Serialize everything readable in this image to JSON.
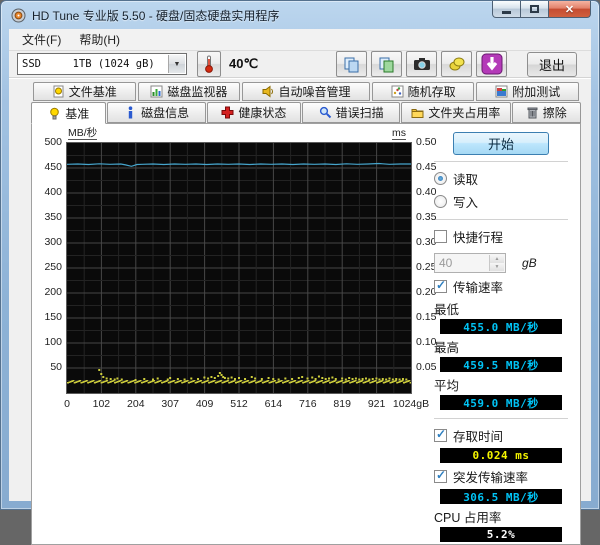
{
  "window_title": "HD Tune 专业版 5.50 - 硬盘/固态硬盘实用程序",
  "menu": {
    "file": "文件(F)",
    "help": "帮助(H)"
  },
  "toolbar": {
    "drive": "SSD     1TB (1024 gB)",
    "temperature": "40℃",
    "exit": "退出"
  },
  "tabs_top": [
    {
      "label": "文件基准"
    },
    {
      "label": "磁盘监视器"
    },
    {
      "label": "自动噪音管理"
    },
    {
      "label": "随机存取"
    },
    {
      "label": "附加测试"
    }
  ],
  "tabs_bottom": [
    {
      "label": "基准",
      "active": true
    },
    {
      "label": "磁盘信息"
    },
    {
      "label": "健康状态"
    },
    {
      "label": "错误扫描"
    },
    {
      "label": "文件夹占用率"
    },
    {
      "label": "擦除"
    }
  ],
  "panel": {
    "start": "开始",
    "read": "读取",
    "write": "写入",
    "short_stroke": "快捷行程",
    "short_stroke_value": "40",
    "short_stroke_unit": "gB",
    "transfer_rate": "传输速率",
    "min_label": "最低",
    "min_value": "455.0 MB/秒",
    "max_label": "最高",
    "max_value": "459.5 MB/秒",
    "avg_label": "平均",
    "avg_value": "459.0 MB/秒",
    "access_time": "存取时间",
    "access_time_value": "0.024 ms",
    "burst": "突发传输速率",
    "burst_value": "306.5 MB/秒",
    "cpu_label": "CPU 占用率",
    "cpu_value": "5.2%"
  },
  "colors": {
    "speed_value_text": "#00c3f5",
    "access_value_text": "#f5f500",
    "cpu_value_text": "#ffffff",
    "read_line": "#46a5cc",
    "access_dots": "#cdcd3c",
    "plot_background": "#0a0a0a"
  },
  "chart_data": {
    "type": "line",
    "title": "",
    "grid": true,
    "left_axis": {
      "label": "MB/秒",
      "min": 0,
      "max": 500,
      "ticks": [
        500,
        450,
        400,
        350,
        300,
        250,
        200,
        150,
        100,
        50
      ]
    },
    "right_axis": {
      "label": "ms",
      "min": 0,
      "max": 0.5,
      "ticks": [
        "0.50",
        "0.45",
        "0.40",
        "0.35",
        "0.30",
        "0.25",
        "0.20",
        "0.15",
        "0.10",
        "0.05"
      ]
    },
    "x_axis": {
      "unit": "gB",
      "min": 0,
      "max": 1024,
      "ticks": [
        "0",
        "102",
        "204",
        "307",
        "409",
        "512",
        "614",
        "716",
        "819",
        "921",
        "1024gB"
      ]
    },
    "series": [
      {
        "name": "读取传输速率",
        "type": "line",
        "color": "#46a5cc",
        "points": [
          [
            0,
            457.5
          ],
          [
            32,
            458
          ],
          [
            64,
            457
          ],
          [
            96,
            458.5
          ],
          [
            128,
            457.5
          ],
          [
            160,
            458
          ],
          [
            176,
            456
          ],
          [
            192,
            453.5
          ],
          [
            208,
            457
          ],
          [
            224,
            457.5
          ],
          [
            256,
            458
          ],
          [
            288,
            457
          ],
          [
            320,
            458
          ],
          [
            352,
            457.5
          ],
          [
            384,
            458
          ],
          [
            416,
            457
          ],
          [
            448,
            458
          ],
          [
            480,
            457.5
          ],
          [
            512,
            458
          ],
          [
            544,
            457
          ],
          [
            576,
            458
          ],
          [
            608,
            457.5
          ],
          [
            640,
            458
          ],
          [
            672,
            457
          ],
          [
            704,
            458
          ],
          [
            736,
            457.5
          ],
          [
            768,
            458
          ],
          [
            800,
            457
          ],
          [
            832,
            458.5
          ],
          [
            864,
            457.5
          ],
          [
            896,
            458
          ],
          [
            928,
            459
          ],
          [
            960,
            457.5
          ],
          [
            992,
            458
          ],
          [
            1024,
            458
          ]
        ]
      },
      {
        "name": "存取时间",
        "type": "scatter",
        "color": "#cdcd3c",
        "baseline": {
          "y_min": 22,
          "y_max": 26,
          "x_step": 4
        },
        "scatter": [
          [
            96,
            48
          ],
          [
            102,
            40
          ],
          [
            108,
            34
          ],
          [
            118,
            31
          ],
          [
            130,
            30
          ],
          [
            142,
            29
          ],
          [
            150,
            31
          ],
          [
            163,
            29
          ],
          [
            204,
            28
          ],
          [
            230,
            30
          ],
          [
            256,
            29
          ],
          [
            270,
            31
          ],
          [
            300,
            29
          ],
          [
            307,
            32
          ],
          [
            330,
            30
          ],
          [
            350,
            29
          ],
          [
            370,
            31
          ],
          [
            390,
            30
          ],
          [
            409,
            33
          ],
          [
            420,
            31
          ],
          [
            430,
            34
          ],
          [
            440,
            32
          ],
          [
            450,
            36
          ],
          [
            455,
            42
          ],
          [
            460,
            38
          ],
          [
            465,
            34
          ],
          [
            470,
            32
          ],
          [
            480,
            31
          ],
          [
            490,
            33
          ],
          [
            500,
            30
          ],
          [
            512,
            32
          ],
          [
            530,
            30
          ],
          [
            550,
            34
          ],
          [
            560,
            31
          ],
          [
            580,
            30
          ],
          [
            600,
            32
          ],
          [
            614,
            30
          ],
          [
            630,
            29
          ],
          [
            650,
            31
          ],
          [
            670,
            30
          ],
          [
            690,
            32
          ],
          [
            700,
            34
          ],
          [
            716,
            31
          ],
          [
            730,
            33
          ],
          [
            740,
            30
          ],
          [
            750,
            35
          ],
          [
            760,
            32
          ],
          [
            770,
            30
          ],
          [
            780,
            31
          ],
          [
            790,
            33
          ],
          [
            800,
            30
          ],
          [
            819,
            31
          ],
          [
            830,
            29
          ],
          [
            840,
            32
          ],
          [
            850,
            30
          ],
          [
            860,
            31
          ],
          [
            870,
            29
          ],
          [
            880,
            30
          ],
          [
            890,
            31
          ],
          [
            900,
            29
          ],
          [
            910,
            30
          ],
          [
            921,
            31
          ],
          [
            930,
            29
          ],
          [
            940,
            30
          ],
          [
            950,
            29
          ],
          [
            960,
            31
          ],
          [
            970,
            29
          ],
          [
            980,
            30
          ],
          [
            990,
            29
          ],
          [
            1000,
            30
          ],
          [
            1010,
            29
          ]
        ]
      }
    ]
  }
}
